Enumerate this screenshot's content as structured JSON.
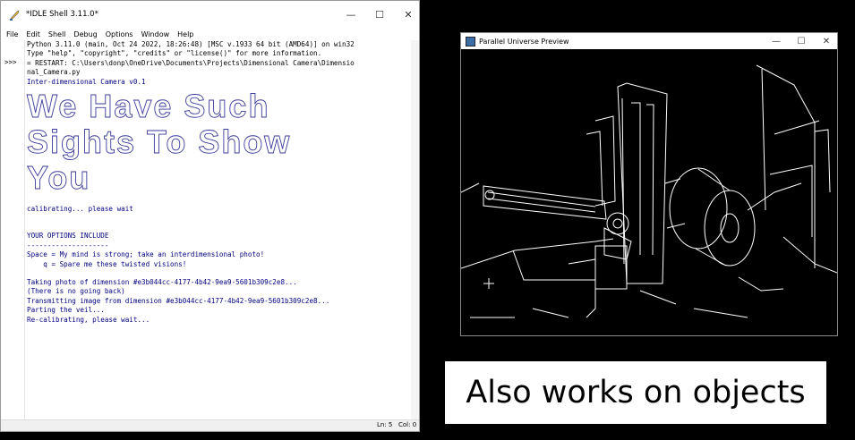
{
  "idle": {
    "title": "*IDLE Shell 3.11.0*",
    "menu": [
      "File",
      "Edit",
      "Shell",
      "Debug",
      "Options",
      "Window",
      "Help"
    ],
    "prompt": ">>>",
    "lines_sys": [
      "Python 3.11.0 (main, Oct 24 2022, 18:26:48) [MSC v.1933 64 bit (AMD64)] on win32",
      "Type \"help\", \"copyright\", \"credits\" or \"license()\" for more information.",
      "",
      "= RESTART: C:\\Users\\donp\\OneDrive\\Documents\\Projects\\Dimensional Camera\\Dimensio",
      "nal_Camera.py"
    ],
    "header": "Inter-dimensional Camera v0.1",
    "ascii_art": [
      "We Have Such",
      "Sights To Show",
      "You"
    ],
    "calibrating": "calibrating... please wait",
    "options_title": "YOUR OPTIONS INCLUDE",
    "options_rule": "--------------------",
    "option_space": "Space = My mind is strong; take an interdimensional photo!",
    "option_q": "    q = Spare me these twisted visions!",
    "log": [
      "Taking photo of dimension #e3b044cc-4177-4b42-9ea9-5601b309c2e8...",
      "(There is no going back)",
      "Transmitting image from dimension #e3b044cc-4177-4b42-9ea9-5601b309c2e8...",
      "Parting the veil...",
      "Re-calibrating, please wait..."
    ],
    "status_ln": "Ln: 5",
    "status_col": "Col: 0"
  },
  "preview": {
    "title": "Parallel Universe Preview"
  },
  "caption": "Also works on objects",
  "controls": {
    "minimize": "—",
    "maximize": "☐",
    "close": "✕"
  }
}
